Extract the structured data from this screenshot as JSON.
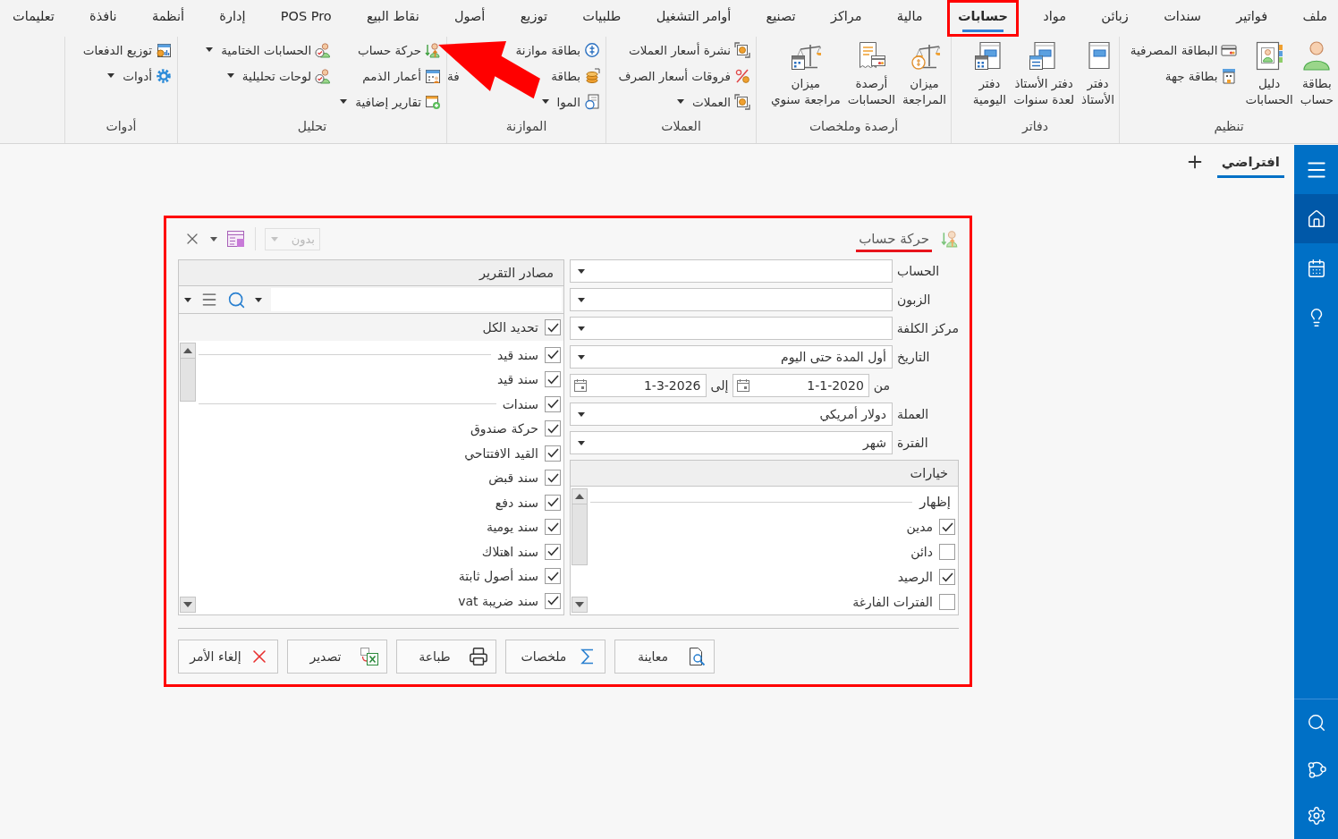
{
  "ribbon": {
    "tabs": [
      {
        "label": "ملف",
        "selected": false
      },
      {
        "label": "فواتير",
        "selected": false
      },
      {
        "label": "سندات",
        "selected": false
      },
      {
        "label": "زبائن",
        "selected": false
      },
      {
        "label": "مواد",
        "selected": false
      },
      {
        "label": "حسابات",
        "selected": true
      },
      {
        "label": "مالية",
        "selected": false
      },
      {
        "label": "مراكز",
        "selected": false
      },
      {
        "label": "تصنيع",
        "selected": false
      },
      {
        "label": "أوامر التشغيل",
        "selected": false
      },
      {
        "label": "طلبيات",
        "selected": false
      },
      {
        "label": "توزيع",
        "selected": false
      },
      {
        "label": "أصول",
        "selected": false
      },
      {
        "label": "نقاط البيع",
        "selected": false
      },
      {
        "label": "POS Pro",
        "selected": false
      },
      {
        "label": "إدارة",
        "selected": false
      },
      {
        "label": "أنظمة",
        "selected": false
      },
      {
        "label": "نافذة",
        "selected": false
      },
      {
        "label": "تعليمات",
        "selected": false
      }
    ],
    "groups": [
      {
        "label": "تنظيم",
        "columns": [
          {
            "kind": "large",
            "label": "بطاقة\nحساب"
          },
          {
            "kind": "large",
            "label": "دليل\nالحسابات"
          },
          {
            "kind": "stack",
            "items": [
              {
                "label": "البطاقة المصرفية",
                "dropdown": false
              },
              {
                "label": "بطاقة جهة",
                "dropdown": false
              }
            ]
          }
        ]
      },
      {
        "label": "دفاتر",
        "columns": [
          {
            "kind": "large",
            "label": "دفتر\nالأستاذ"
          },
          {
            "kind": "large",
            "label": "دفتر الأستاذ\nلعدة سنوات"
          },
          {
            "kind": "large",
            "label": "دفتر\nاليومية"
          }
        ]
      },
      {
        "label": "أرصدة وملخصات",
        "columns": [
          {
            "kind": "large",
            "label": "ميزان\nالمراجعة"
          },
          {
            "kind": "large",
            "label": "أرصدة\nالحسابات"
          },
          {
            "kind": "large",
            "label": "ميزان\nمراجعة سنوي"
          }
        ]
      },
      {
        "label": "العملات",
        "columns": [
          {
            "kind": "stack",
            "items": [
              {
                "label": "نشرة أسعار العملات",
                "dropdown": false
              },
              {
                "label": "فروقات أسعار الصرف",
                "dropdown": false
              },
              {
                "label": "العملات",
                "dropdown": true
              }
            ]
          }
        ]
      },
      {
        "label": "الموازنة",
        "columns": [
          {
            "kind": "stack",
            "items": [
              {
                "label": "بطاقة موازنة",
                "dropdown": false
              },
              {
                "label": "بطاقة",
                "tail": "فة",
                "dropdown": false
              },
              {
                "label": "الموا",
                "dropdown": true
              }
            ]
          }
        ]
      },
      {
        "label": "تحليل",
        "columns": [
          {
            "kind": "stack",
            "items": [
              {
                "label": "حركة حساب",
                "dropdown": false
              },
              {
                "label": "أعمار الذمم",
                "dropdown": false
              },
              {
                "label": "تقارير إضافية",
                "dropdown": true
              }
            ]
          },
          {
            "kind": "stack",
            "items": [
              {
                "label": "الحسابات الختامية",
                "dropdown": true
              },
              {
                "label": "لوحات تحليلية",
                "dropdown": true
              }
            ]
          }
        ]
      },
      {
        "label": "أدوات",
        "columns": [
          {
            "kind": "stack",
            "items": [
              {
                "label": "توزيع الدفعات",
                "dropdown": false
              },
              {
                "label": "أدوات",
                "dropdown": true
              }
            ]
          }
        ]
      }
    ]
  },
  "annotations": {
    "tab_outline": true,
    "dialog_outline": true,
    "arrow": true
  },
  "sidebar": {
    "items": [
      {
        "selected": true
      },
      {
        "selected": false
      },
      {
        "selected": false
      }
    ]
  },
  "doc_tabs": [
    {
      "label": "افتراضي",
      "selected": true
    }
  ],
  "dialog": {
    "title": "حركة حساب",
    "layout_select": {
      "value": "بدون",
      "disabled": true
    },
    "form": {
      "fields": [
        {
          "kind": "combo",
          "label": "الحساب"
        },
        {
          "kind": "combo",
          "label": "الزبون"
        },
        {
          "kind": "combo",
          "label": "مركز الكلفة"
        },
        {
          "kind": "combo",
          "label": "التاريخ",
          "value": "أول المدة حتى اليوم"
        },
        {
          "kind": "date_range",
          "label": "من",
          "value": "1-1-2020",
          "to_label": "إلى",
          "to_value": "1-3-2026"
        },
        {
          "kind": "combo",
          "label": "العملة",
          "value": "دولار أمريكي"
        },
        {
          "kind": "combo",
          "label": "الفترة",
          "value": "شهر"
        }
      ]
    },
    "options": {
      "title": "خيارات",
      "sections": [
        {
          "label": "إظهار",
          "items": [
            {
              "label": "مدين",
              "checked": true
            },
            {
              "label": "دائن",
              "checked": false
            },
            {
              "label": "الرصيد",
              "checked": true
            },
            {
              "label": "الفترات الفارغة",
              "checked": false
            }
          ]
        }
      ]
    },
    "sources": {
      "title": "مصادر التقرير",
      "select_all": {
        "label": "تحديد الكل",
        "checked": true
      },
      "groups": [
        {
          "label": "سند قيد",
          "checked": true,
          "children": [
            {
              "label": "سند قيد",
              "checked": true
            }
          ]
        },
        {
          "label": "سندات",
          "checked": true,
          "children": [
            {
              "label": "حركة صندوق",
              "checked": true
            },
            {
              "label": "القيد الافتتاحي",
              "checked": true
            },
            {
              "label": "سند قبض",
              "checked": true
            },
            {
              "label": "سند دفع",
              "checked": true
            },
            {
              "label": "سند يومية",
              "checked": true
            },
            {
              "label": "سند اهتلاك",
              "checked": true
            },
            {
              "label": "سند أصول ثابتة",
              "checked": true
            },
            {
              "label": "سند ضريبة vat",
              "checked": true
            }
          ]
        }
      ]
    },
    "buttons": [
      {
        "label": "معاينة"
      },
      {
        "label": "ملخصات"
      },
      {
        "label": "طباعة"
      },
      {
        "label": "تصدير"
      },
      {
        "label": "إلغاء الأمر"
      }
    ]
  }
}
